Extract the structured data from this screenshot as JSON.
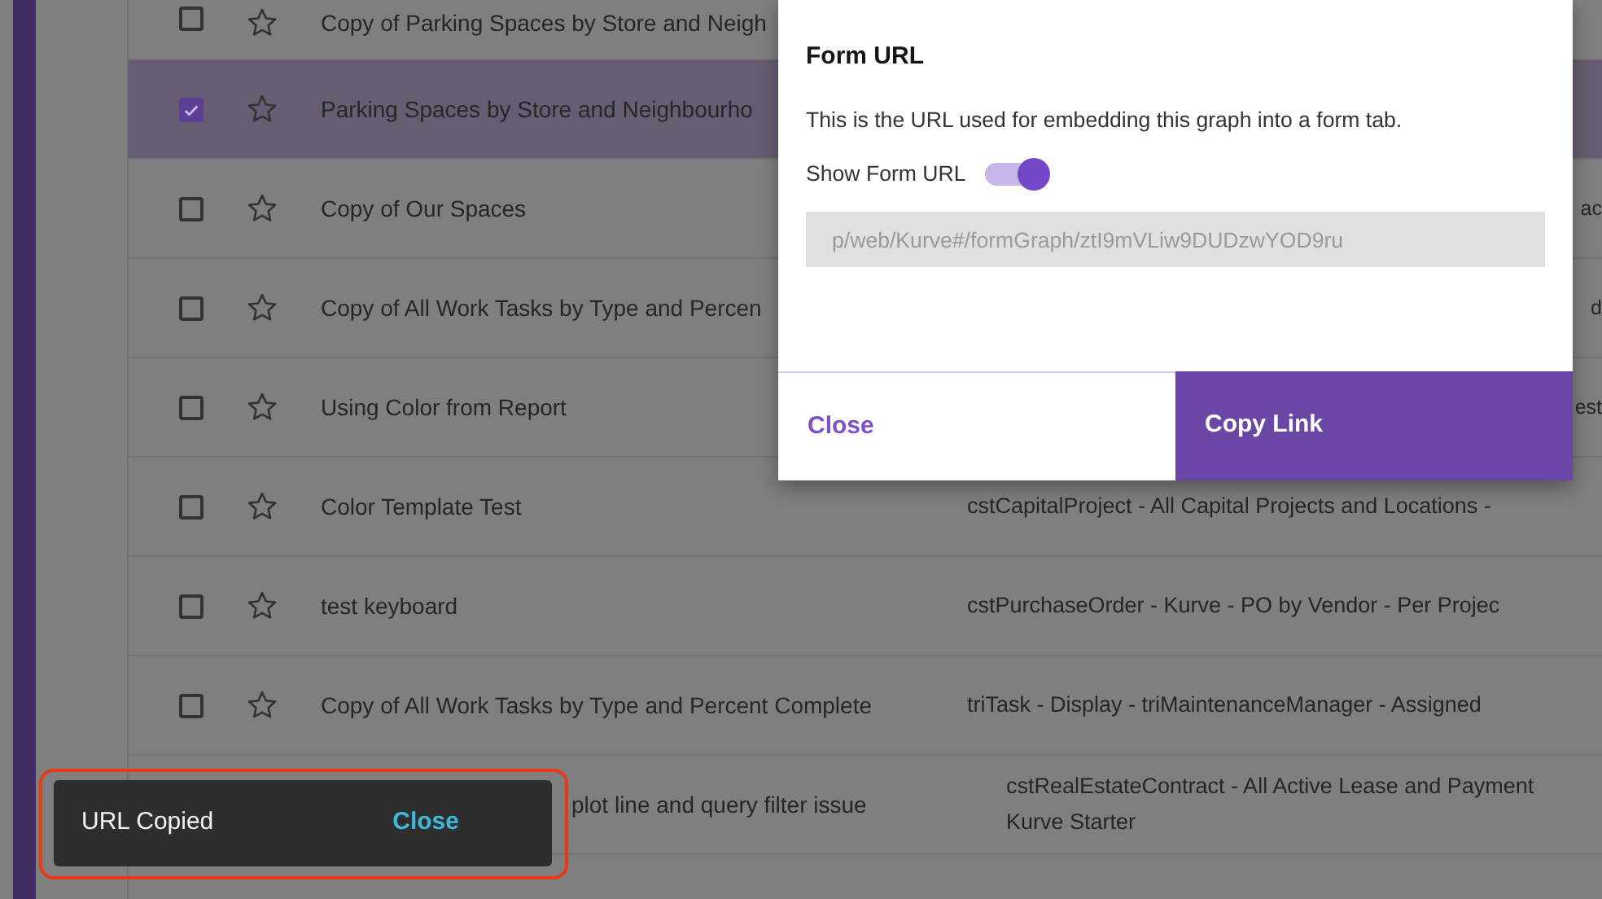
{
  "rows": [
    {
      "kind": "row",
      "checked": false,
      "favorite": false,
      "selected": false,
      "title": "Copy of Parking Spaces by Store and Neigh"
    },
    {
      "kind": "row",
      "checked": true,
      "favorite": false,
      "selected": true,
      "title": "Parking Spaces by Store and Neighbourho"
    },
    {
      "kind": "row",
      "checked": false,
      "favorite": false,
      "selected": false,
      "title": "Copy of Our Spaces",
      "column_2": "ac"
    },
    {
      "kind": "row",
      "checked": false,
      "favorite": false,
      "selected": false,
      "title": "Copy of All Work Tasks by Type and Percen",
      "column_2": "d"
    },
    {
      "kind": "row",
      "checked": false,
      "favorite": false,
      "selected": false,
      "title": "Using Color from Report",
      "column_2": "est"
    },
    {
      "kind": "row",
      "checked": false,
      "favorite": false,
      "selected": false,
      "title": "Color Template Test",
      "column_2": "cstCapitalProject - All Capital Projects and Locations -"
    },
    {
      "kind": "row",
      "checked": false,
      "favorite": false,
      "selected": false,
      "title": "test keyboard",
      "column_2": "cstPurchaseOrder - Kurve - PO by Vendor - Per Projec"
    },
    {
      "kind": "row",
      "checked": false,
      "favorite": false,
      "selected": false,
      "title": "Copy of All Work Tasks by Type and Percent Complete",
      "column_2": "triTask - Display - triMaintenanceManager - Assigned"
    },
    {
      "kind": "covered",
      "selected": false,
      "title": "plot line and query filter issue",
      "column_2": "cstRealEstateContract - All Active Lease and Payment",
      "column_2_line_2": "Kurve Starter"
    }
  ],
  "modal": {
    "title": "Form URL",
    "description": "This is the URL used for embedding this graph into a form tab.",
    "toggle": {
      "label": "Show Form URL",
      "on": true
    },
    "url_field": {
      "value": "p/web/Kurve#/formGraph/ztI9mVLiw9DUDzwYOD9ru"
    },
    "buttons": [
      {
        "label": "Close",
        "kind": "secondary"
      },
      {
        "label": "Copy Link",
        "kind": "primary"
      }
    ]
  },
  "snackbar": {
    "message": "URL Copied",
    "action": "Close",
    "highlighted": true
  }
}
